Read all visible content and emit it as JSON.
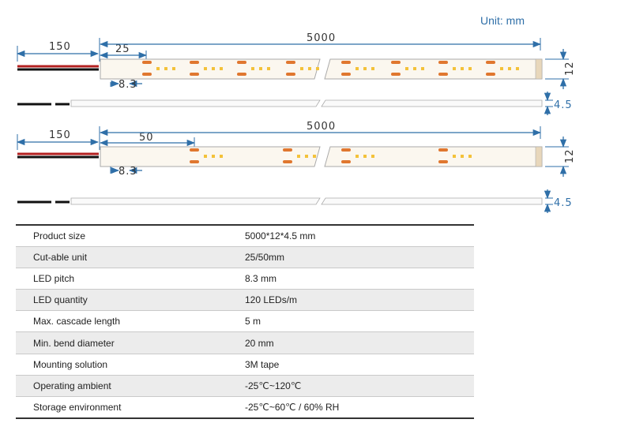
{
  "unit_label": "Unit: mm",
  "strip_5050_25": {
    "wire_length": "150",
    "cut_unit": "25",
    "total_length": "5000",
    "led_pitch": "8.3",
    "width": "12",
    "thickness": "4.5"
  },
  "strip_50": {
    "wire_length": "150",
    "cut_unit": "50",
    "total_length": "5000",
    "led_pitch": "8.3",
    "width": "12",
    "thickness": "4.5"
  },
  "specs": [
    {
      "label": "Product size",
      "value": "5000*12*4.5 mm"
    },
    {
      "label": "Cut-able unit",
      "value": "25/50mm"
    },
    {
      "label": "LED pitch",
      "value": "8.3 mm"
    },
    {
      "label": "LED quantity",
      "value": "120 LEDs/m"
    },
    {
      "label": "Max. cascade length",
      "value": "5 m"
    },
    {
      "label": "Min. bend diameter",
      "value": "20 mm"
    },
    {
      "label": "Mounting solution",
      "value": "3M tape"
    },
    {
      "label": "Operating ambient",
      "value": "-25℃~120℃"
    },
    {
      "label": "Storage environment",
      "value": "-25℃~60℃ / 60% RH"
    }
  ],
  "colors": {
    "dimension_line": "#2f6fa8",
    "led_orange": "#e0772f",
    "led_yellow": "#f3c23a",
    "wire_red": "#b32020",
    "wire_black": "#111111",
    "strip_bg": "#fbf7ef"
  }
}
